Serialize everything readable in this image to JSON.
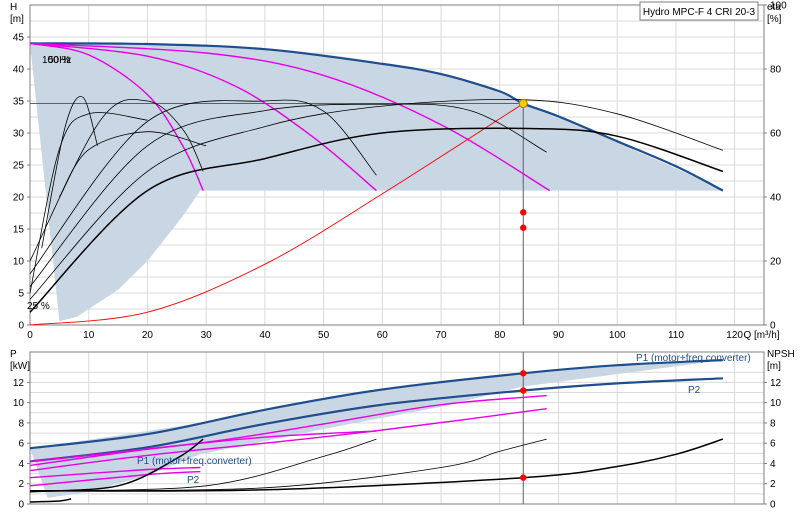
{
  "title": "Hydro MPC-F 4 CRI 20-3",
  "colors": {
    "band": "#c9d6e4",
    "main_curve": "#1f4e8c",
    "speed_curve": "#e600e6",
    "eta_curve": "#000000",
    "system_curve": "#ff0000",
    "duty_point": "#ff0000",
    "duty_marker": "#ffcc00",
    "grid": "#d9d9d9"
  },
  "annotations": {
    "freq_top": "100 %",
    "freq_top2": "50Hz",
    "min_speed": "25 %",
    "p1_top": "P1 (motor+freq.converter)",
    "p2_top": "P2",
    "p1_low": "P1 (motor+freq.converter)",
    "p2_low": "P2"
  },
  "chart_data": [
    {
      "type": "line",
      "panel": "head",
      "xlabel": "Q [m³/h]",
      "ylabel": "H\n[m]",
      "y2label": "eta\n[%]",
      "xlim": [
        0,
        125
      ],
      "ylim": [
        0,
        50
      ],
      "y2lim": [
        0,
        100
      ],
      "xticks": [
        0,
        10,
        20,
        30,
        40,
        50,
        60,
        70,
        80,
        90,
        100,
        110,
        120
      ],
      "yticks": [
        0,
        5,
        10,
        15,
        20,
        25,
        30,
        35,
        40,
        45
      ],
      "y2ticks": [
        0,
        20,
        40,
        60,
        80,
        100
      ],
      "band": {
        "upper": [
          [
            0,
            44
          ],
          [
            30,
            43.8
          ],
          [
            50,
            42.3
          ],
          [
            70,
            39.2
          ],
          [
            85,
            34.5
          ],
          [
            100,
            28.5
          ],
          [
            110,
            24.5
          ],
          [
            118,
            21
          ]
        ],
        "lower": [
          [
            118,
            21
          ],
          [
            29,
            21
          ],
          [
            26,
            17
          ],
          [
            20,
            10
          ],
          [
            15,
            5.5
          ],
          [
            10,
            2.5
          ],
          [
            8,
            1.3
          ],
          [
            5,
            0.6
          ]
        ]
      },
      "series": [
        {
          "kind": "head",
          "style": "main",
          "points": [
            [
              0,
              44
            ],
            [
              20,
              43.9
            ],
            [
              40,
              43.1
            ],
            [
              60,
              40.8
            ],
            [
              70,
              39.2
            ],
            [
              80,
              36.5
            ],
            [
              84,
              34.6
            ],
            [
              90,
              32.6
            ],
            [
              100,
              28.7
            ],
            [
              110,
              24.8
            ],
            [
              118,
              21
            ]
          ]
        },
        {
          "kind": "head",
          "style": "speed",
          "points": [
            [
              0,
              44
            ],
            [
              10,
              42.2
            ],
            [
              20,
              36
            ],
            [
              26,
              28
            ],
            [
              29.5,
              21
            ]
          ]
        },
        {
          "kind": "head",
          "style": "speed",
          "points": [
            [
              0,
              44
            ],
            [
              20,
              42
            ],
            [
              35,
              37.3
            ],
            [
              48,
              29.5
            ],
            [
              59,
              21
            ]
          ]
        },
        {
          "kind": "head",
          "style": "speed",
          "points": [
            [
              0,
              44
            ],
            [
              30,
              42.5
            ],
            [
              50,
              39
            ],
            [
              70,
              31.3
            ],
            [
              88.5,
              21
            ]
          ]
        },
        {
          "kind": "system",
          "style": "system",
          "points": [
            [
              0,
              0
            ],
            [
              20,
              2
            ],
            [
              40,
              9.5
            ],
            [
              60,
              20.5
            ],
            [
              84,
              34.6
            ]
          ]
        },
        {
          "kind": "eta",
          "style": "eta",
          "points": [
            [
              0,
              2
            ],
            [
              20,
              21
            ],
            [
              40,
              26
            ],
            [
              60,
              30
            ],
            [
              85,
              30.7
            ],
            [
              100,
              29.5
            ],
            [
              118,
              24
            ]
          ]
        },
        {
          "kind": "eta",
          "style": "eta-thin",
          "points": [
            [
              0,
              4
            ],
            [
              20,
              24
            ],
            [
              40,
              31
            ],
            [
              60,
              34.2
            ],
            [
              84,
              35.2
            ],
            [
              100,
              33
            ],
            [
              118,
              27.3
            ]
          ]
        },
        {
          "kind": "eta",
          "style": "eta-thin",
          "points": [
            [
              0,
              6
            ],
            [
              20,
              28
            ],
            [
              40,
              33.5
            ],
            [
              60,
              34.5
            ],
            [
              75,
              33.5
            ],
            [
              88,
              27
            ]
          ]
        },
        {
          "kind": "eta",
          "style": "eta-thin",
          "points": [
            [
              0,
              8
            ],
            [
              20,
              31.8
            ],
            [
              40,
              35
            ],
            [
              50,
              33.4
            ],
            [
              59,
              23.4
            ]
          ]
        },
        {
          "kind": "eta",
          "style": "eta-thin",
          "points": [
            [
              0,
              10
            ],
            [
              12,
              32
            ],
            [
              20,
              35
            ],
            [
              26,
              30.6
            ],
            [
              29.5,
              24
            ]
          ]
        },
        {
          "kind": "eta",
          "style": "eta-thin",
          "points": [
            [
              2,
              12
            ],
            [
              6,
              31
            ],
            [
              9,
              35.6
            ],
            [
              11.5,
              28
            ]
          ]
        },
        {
          "kind": "eta",
          "style": "eta-thin",
          "points": [
            [
              0,
              5
            ],
            [
              5,
              27.5
            ],
            [
              10,
              33
            ],
            [
              20,
              32
            ]
          ]
        },
        {
          "kind": "eta",
          "style": "eta-thin",
          "points": [
            [
              5,
              20
            ],
            [
              10,
              27.4
            ],
            [
              20,
              30.2
            ],
            [
              30,
              28
            ]
          ]
        }
      ],
      "markers": [
        {
          "x": 84,
          "y": 34.6,
          "style": "duty"
        },
        {
          "x": 84,
          "y": 17.6,
          "style": "red"
        },
        {
          "x": 84,
          "y": 15.2,
          "style": "red"
        }
      ],
      "guides": {
        "x": 84,
        "y": 34.6
      }
    },
    {
      "type": "line",
      "panel": "power",
      "xlabel": "",
      "ylabel": "P\n[kW]",
      "y2label": "NPSH\n[m]",
      "xlim": [
        0,
        125
      ],
      "ylim": [
        0,
        15
      ],
      "y2lim": [
        0,
        15
      ],
      "yticks": [
        0,
        2,
        4,
        6,
        8,
        10,
        12
      ],
      "y2ticks": [
        0,
        2,
        4,
        6,
        8,
        10,
        12
      ],
      "band": {
        "upper": [
          [
            0,
            5.5
          ],
          [
            30,
            8.1
          ],
          [
            50,
            10.3
          ],
          [
            70,
            12
          ],
          [
            84,
            13
          ],
          [
            100,
            13.6
          ],
          [
            118,
            14.2
          ]
        ],
        "lower": [
          [
            118,
            14.2
          ],
          [
            84,
            11.6
          ],
          [
            70,
            9.6
          ],
          [
            50,
            7.4
          ],
          [
            29,
            4.9
          ],
          [
            20,
            2.8
          ],
          [
            10,
            1.2
          ],
          [
            3,
            0.6
          ]
        ]
      },
      "series": [
        {
          "kind": "power",
          "style": "main",
          "points": [
            [
              0,
              5.5
            ],
            [
              20,
              6.9
            ],
            [
              40,
              9.3
            ],
            [
              60,
              11.3
            ],
            [
              84,
              12.9
            ],
            [
              100,
              13.7
            ],
            [
              118,
              14.2
            ]
          ]
        },
        {
          "kind": "power",
          "style": "main",
          "points": [
            [
              0,
              4.2
            ],
            [
              20,
              5.6
            ],
            [
              40,
              7.9
            ],
            [
              60,
              9.8
            ],
            [
              84,
              11.2
            ],
            [
              100,
              11.9
            ],
            [
              118,
              12.4
            ]
          ]
        },
        {
          "kind": "power",
          "style": "speed",
          "points": [
            [
              0,
              4.2
            ],
            [
              30,
              6.1
            ],
            [
              50,
              7.9
            ],
            [
              70,
              9.8
            ],
            [
              88,
              10.7
            ]
          ]
        },
        {
          "kind": "power",
          "style": "speed",
          "points": [
            [
              0,
              3.8
            ],
            [
              20,
              5.4
            ],
            [
              40,
              6.6
            ],
            [
              59,
              7.2
            ]
          ]
        },
        {
          "kind": "power",
          "style": "speed",
          "points": [
            [
              0,
              2.6
            ],
            [
              20,
              3.4
            ],
            [
              29,
              3.6
            ]
          ]
        },
        {
          "kind": "power",
          "style": "speed",
          "points": [
            [
              0,
              3.3
            ],
            [
              20,
              4.8
            ],
            [
              40,
              6
            ],
            [
              60,
              7.3
            ],
            [
              88,
              9.4
            ]
          ]
        },
        {
          "kind": "power",
          "style": "speed",
          "points": [
            [
              0,
              1.8
            ],
            [
              20,
              2.9
            ],
            [
              29,
              3.2
            ]
          ]
        },
        {
          "kind": "npsh",
          "style": "eta",
          "points": [
            [
              0,
              1.3
            ],
            [
              40,
              1.4
            ],
            [
              84,
              2.6
            ],
            [
              100,
              3.7
            ],
            [
              110,
              4.9
            ],
            [
              118,
              6.4
            ]
          ]
        },
        {
          "kind": "npsh",
          "style": "eta-thin",
          "points": [
            [
              0,
              1.3
            ],
            [
              40,
              1.6
            ],
            [
              70,
              3.6
            ],
            [
              80,
              5.2
            ],
            [
              88,
              6.4
            ]
          ]
        },
        {
          "kind": "npsh",
          "style": "eta-thin",
          "points": [
            [
              0,
              1.3
            ],
            [
              30,
              1.8
            ],
            [
              50,
              4.7
            ],
            [
              59,
              6.4
            ]
          ]
        },
        {
          "kind": "npsh",
          "style": "eta",
          "points": [
            [
              0,
              1.2
            ],
            [
              15,
              1.8
            ],
            [
              25,
              4.5
            ],
            [
              29.5,
              6.4
            ]
          ]
        },
        {
          "kind": "npsh",
          "style": "eta",
          "points": [
            [
              0,
              0.2
            ],
            [
              5,
              0.3
            ],
            [
              7,
              0.5
            ]
          ]
        }
      ],
      "markers": [
        {
          "x": 84,
          "y": 12.9,
          "style": "red"
        },
        {
          "x": 84,
          "y": 11.2,
          "style": "red"
        },
        {
          "x": 84,
          "y": 2.6,
          "style": "red"
        }
      ],
      "guides": {
        "x": 84
      }
    }
  ]
}
